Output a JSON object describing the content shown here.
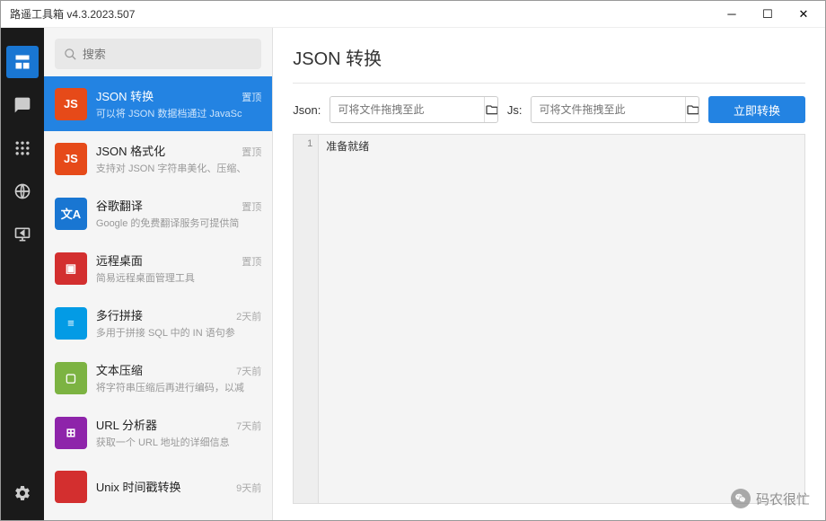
{
  "window": {
    "title": "路遥工具箱 v4.3.2023.507"
  },
  "search": {
    "placeholder": "搜索"
  },
  "tools": [
    {
      "title": "JSON 转换",
      "desc": "可以将 JSON 数据档通过 JavaSc",
      "badge": "置顶",
      "color": "#e64a19",
      "iconText": "JS",
      "selected": true
    },
    {
      "title": "JSON 格式化",
      "desc": "支持对 JSON 字符串美化、压缩、",
      "badge": "置顶",
      "color": "#e64a19",
      "iconText": "JS"
    },
    {
      "title": "谷歌翻译",
      "desc": "Google 的免费翻译服务可提供简",
      "badge": "置顶",
      "color": "#1976d2",
      "iconText": "文A"
    },
    {
      "title": "远程桌面",
      "desc": "简易远程桌面管理工具",
      "badge": "置顶",
      "color": "#d32f2f",
      "iconText": "▣"
    },
    {
      "title": "多行拼接",
      "desc": "多用于拼接 SQL 中的 IN 语句参",
      "badge": "2天前",
      "color": "#039be5",
      "iconText": "≡"
    },
    {
      "title": "文本压缩",
      "desc": "将字符串压缩后再进行编码，以减",
      "badge": "7天前",
      "color": "#7cb342",
      "iconText": "▢"
    },
    {
      "title": "URL 分析器",
      "desc": "获取一个 URL 地址的详细信息",
      "badge": "7天前",
      "color": "#8e24aa",
      "iconText": "⊞"
    },
    {
      "title": "Unix 时间戳转换",
      "desc": "",
      "badge": "9天前",
      "color": "#d32f2f",
      "iconText": ""
    }
  ],
  "page": {
    "title": "JSON 转换",
    "jsonLabel": "Json:",
    "jsLabel": "Js:",
    "filePlaceholder": "可将文件拖拽至此",
    "convert": "立即转换",
    "lineNumber": "1",
    "statusText": "准备就绪"
  },
  "watermark": {
    "text": "码农很忙"
  }
}
